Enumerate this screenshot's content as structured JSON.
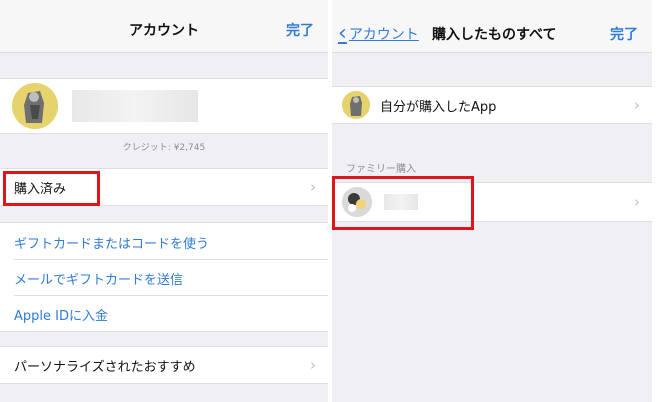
{
  "left": {
    "nav": {
      "title": "アカウント",
      "done_label": "完了"
    },
    "credit": "クレジット: ¥2,745",
    "purchased_label": "購入済み",
    "links": [
      "ギフトカードまたはコードを使う",
      "メールでギフトカードを送信",
      "Apple IDに入金"
    ],
    "personalized_label": "パーソナライズされたおすすめ"
  },
  "right": {
    "nav": {
      "back_label": "アカウント",
      "title": "購入したものすべて",
      "done_label": "完了"
    },
    "my_purchases_label": "自分が購入したApp",
    "family_section_label": "ファミリー購入"
  },
  "icons": {
    "chevron": "chevron-right-icon",
    "back": "chevron-left-icon"
  },
  "colors": {
    "accent": "#2f7bd9",
    "highlight": "#e0151b",
    "avatar_bg": "#e6d36d"
  }
}
